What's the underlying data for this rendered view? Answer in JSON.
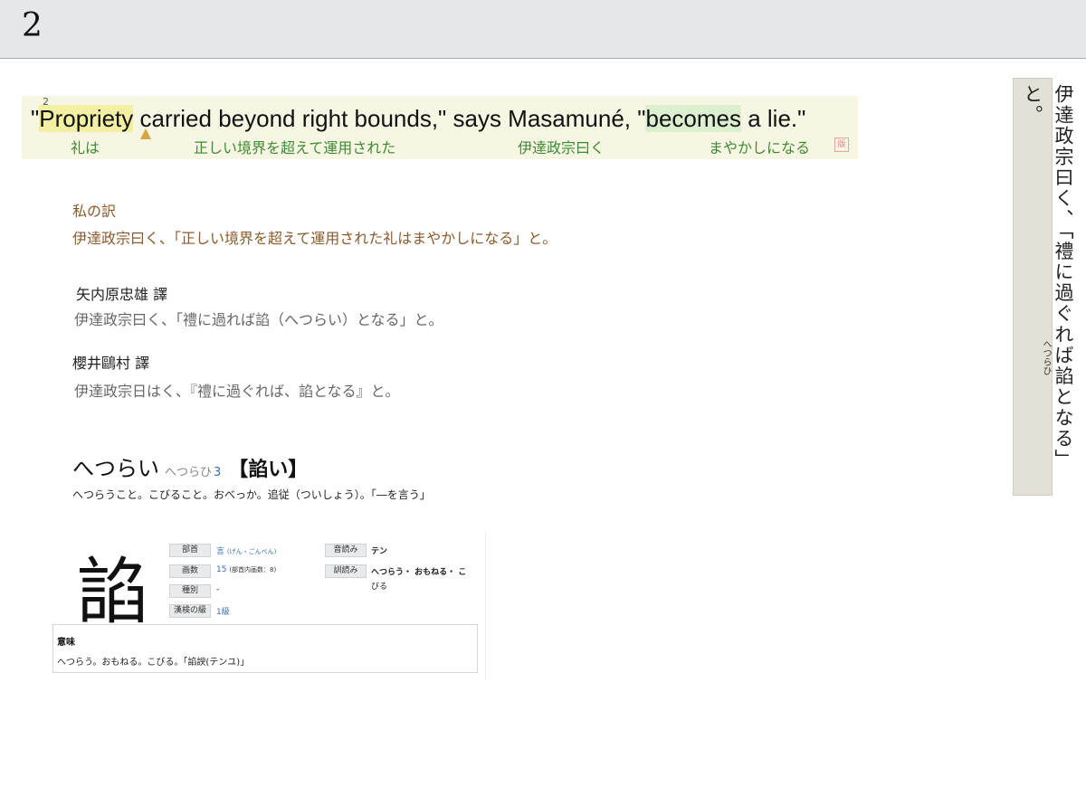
{
  "page_number": "2",
  "sentence": {
    "footnote": "2",
    "en_before": "\"",
    "en_word1": "Propriety",
    "en_mid": " carried beyond right bounds,\" says Masamuné, \"",
    "en_word2": "becomes",
    "en_after": " a lie.\"",
    "gloss": [
      "礼は",
      "正しい境界を超えて運用された",
      "伊達政宗曰く",
      "まやかしになる"
    ],
    "stamp": "版"
  },
  "my_translation": {
    "title": "私の訳",
    "text": "伊達政宗曰く、「正しい境界を超えて運用された礼はまやかしになる」と。"
  },
  "translations": [
    {
      "name": "矢内原忠雄 譯",
      "text": "伊達政宗曰く、「禮に過れば諂（へつらい）となる」と。"
    },
    {
      "name": "櫻井鷗村 譯",
      "text": "伊達政宗日はく、『禮に過ぐれば、諂となる』と。"
    }
  ],
  "dictionary": {
    "word": "へつらい",
    "reading": "へつらひ",
    "number": "3",
    "kanji_form": "【諂い】",
    "definition": "へつらうこと。こびること。おべっか。追従（ついしょう）。「―を言う」"
  },
  "kanji_card": {
    "kanji": "諂",
    "radical_label": "部首",
    "radical_value": "言",
    "radical_note": "(げん・ごんべん)",
    "strokes_label": "画数",
    "strokes_value": "15",
    "strokes_note": "(部首内画数：8)",
    "type_label": "種別",
    "type_value": "-",
    "kanken_label": "漢検の級",
    "kanken_value": "1級",
    "on_label": "音読み",
    "on_value": "テン",
    "kun_label": "訓読み",
    "kun_value_1": "へつらう・ おもねる・ こ",
    "kun_value_2": "びる",
    "meaning_title": "意味",
    "meaning_text": "へつらう。おもねる。こびる。「諂諛(テンユ)」"
  },
  "scan": {
    "text": "伊達政宗曰く、「禮に過ぐれば諂となる」と。",
    "ruby": "へつらひ"
  }
}
